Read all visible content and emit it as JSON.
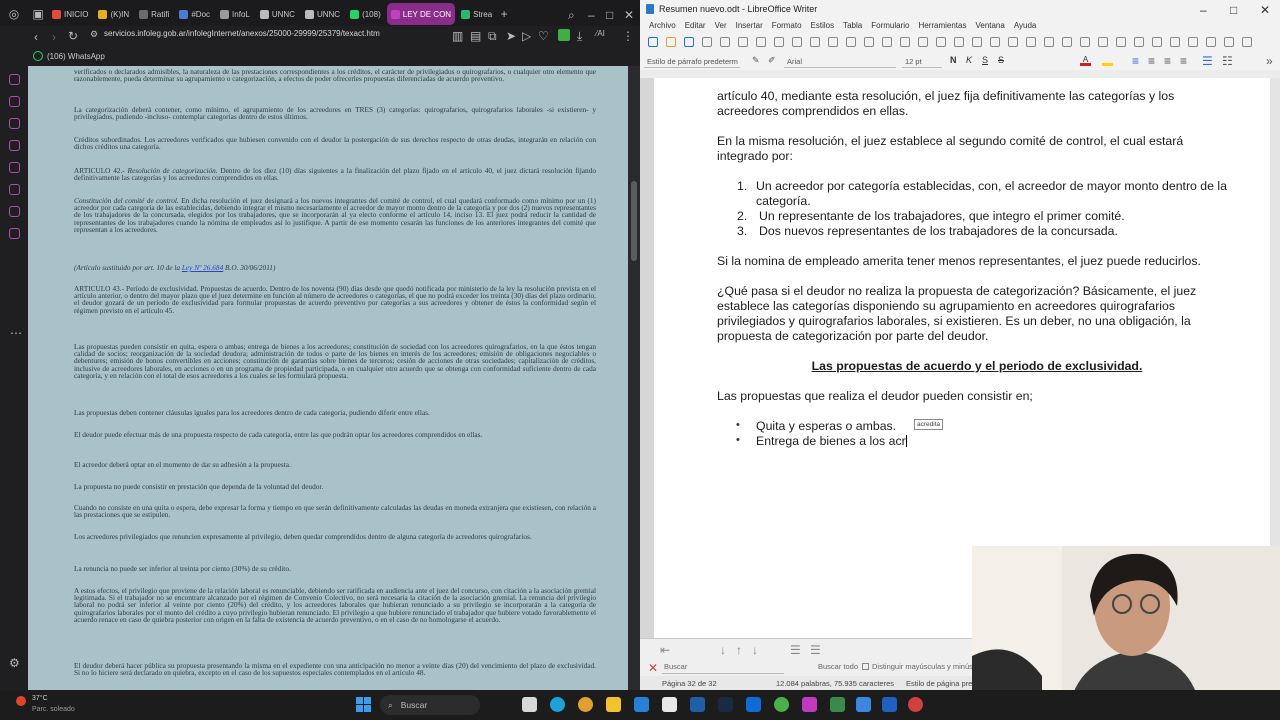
{
  "browser": {
    "tabs": [
      {
        "label": "INICIO",
        "color": "#e04b3a"
      },
      {
        "label": "(K)IN",
        "color": "#e8b020"
      },
      {
        "label": "Ratifi",
        "color": "#6b6b6b"
      },
      {
        "label": "#Doc",
        "color": "#4a7bd0"
      },
      {
        "label": "InfoL",
        "color": "#9a9a9a"
      },
      {
        "label": "UNNC",
        "color": "#bbbbbb"
      },
      {
        "label": "UNNC",
        "color": "#bbbbbb"
      },
      {
        "label": "(108)",
        "color": "#25d366"
      },
      {
        "label": "LEY DE CON",
        "color": "#c040c0",
        "active": true
      },
      {
        "label": "Strea",
        "color": "#2bb673"
      }
    ],
    "url": "servicios.infoleg.gob.ar/infolegInternet/anexos/25000-29999/25379/texact.htm",
    "bookmark": "(106) WhatsApp",
    "document": {
      "p1": "verificados o declarados admisibles, la naturaleza de las prestaciones correspondientes a los créditos, el carácter de privilegiados o quirografarios, o cualquier otro elemento que razonablemente, pueda determinar su agrupamiento o categorización, a efectos de poder ofrecerles propuestas diferenciadas de acuerdo preventivo.",
      "p2": "La categorización deberá contener, como mínimo, el agrupamiento de los acreedores en TRES (3) categorías: quirografarios, quirografarios laborales -si existieren- y privilegiados, pudiendo -incluso- contemplar categorías dentro de estos últimos.",
      "p3": "Créditos subordinados. Los acreedores verificados que hubiesen convenido con el deudor la postergación de sus derechos respecto de otras deudas, integrarán en relación con dichos créditos una categoría.",
      "p4a": "ARTICULO 42.- ",
      "p4b": "Resolución de categorización.",
      "p4c": " Dentro de los diez (10) días siguientes a la finalización del plazo fijado en el artículo 40, el juez dictará resolución fijando definitivamente las categorías y los acreedores comprendidos en ellas.",
      "p5a": "Constitución del comité de control.",
      "p5b": " En dicha resolución el juez designará a los nuevos integrantes del comité de control, el cual quedará conformado como mínimo por un (1) acreedor por cada categoría de las establecidas, debiendo integrar el mismo necesariamente el acreedor de mayor monto dentro de la categoría y por dos (2) nuevos representantes de los trabajadores de la concursada, elegidos por los trabajadores, que se incorporarán al ya electo conforme el artículo 14, inciso 13. El juez podrá reducir la cantidad de representantes de los trabajadores cuando la nómina de empleados así lo justifique. A partir de ese momento cesarán las funciones de los anteriores integrantes del comité que representan a los acreedores.",
      "p6a": "(Artículo sustituido por art. 10 de la ",
      "p6link": "Ley Nº 26.684",
      "p6b": " B.O. 30/06/2011)",
      "p7": "ARTICULO 43.- Período de exclusividad. Propuestas de acuerdo. Dentro de los noventa (90) días desde que quedó notificada por ministerio de la ley la resolución prevista en el artículo anterior, o dentro del mayor plazo que el juez determine en función al número de acreedores o categorías, el que no podrá exceder los treinta (30) días del plazo ordinario, el deudor gozará de un período de exclusividad para formular propuestas de acuerdo preventivo por categorías a sus acreedores y obtener de éstos la conformidad según el régimen previsto en el artículo 45.",
      "p8": "Las propuestas pueden consistir en quita, espera o ambas; entrega de bienes a los acreedores; constitución de sociedad con los acreedores quirografarios, en la que éstos tengan calidad de socios; reorganización de la sociedad deudora; administración de todos o parte de los bienes en interés de los acreedores; emisión de obligaciones negociables o debentures; emisión de bonos convertibles en acciones; constitución de garantías sobre bienes de terceros; cesión de acciones de otras sociedades; capitalización de créditos, inclusive de acreedores laborales, en acciones o en un programa de propiedad participada, o en cualquier otro acuerdo que se obtenga con conformidad suficiente dentro de cada categoría, y en relación con el total de esos acreedores a los cuales se les formulará propuesta.",
      "p9": "Las propuestas deben contener cláusulas iguales para los acreedores dentro de cada categoría, pudiendo diferir entre ellas.",
      "p10": "El deudor puede efectuar más de una propuesta respecto de cada categoría, entre las que podrán optar los acreedores comprendidos en ellas.",
      "p11": "El acreedor deberá optar en el momento de dar su adhesión a la propuesta.",
      "p12": "La propuesta no puede consistir en prestación que dependa de la voluntad del deudor.",
      "p13": "Cuando no consiste en una quita o espera, debe expresar la forma y tiempo en que serán definitivamente calculadas las deudas en moneda extranjera que existiesen, con relación a las prestaciones que se estipulen.",
      "p14": "Los acreedores privilegiados que renuncien expresamente al privilegio, deben quedar comprendidos dentro de alguna categoría de acreedores quirografarios.",
      "p15": "La renuncia no puede ser inferior al treinta por ciento (30%) de su crédito.",
      "p16": "A estos efectos, el privilegio que proviene de la relación laboral es renunciable, debiendo ser ratificada en audiencia ante el juez del concurso, con citación a la asociación gremial legitimada. Si el trabajador no se encontrare alcanzado por el régimen de Convenio Colectivo, no será necesaria la citación de la asociación gremial. La renuncia del privilegio laboral no podrá ser inferior al veinte por ciento (20%) del crédito, y los acreedores laborales que hubieran renunciado a su privilegio se incorporarán a la categoría de quirografarios laborales por el monto del crédito a cuyo privilegio hubieran renunciado. El privilegio a que hubiere renunciado el trabajador que hubiere votado favorablemente el acuerdo renace en caso de quiebra posterior con origen en la falta de existencia de acuerdo preventivo, o en el caso de no homologarse el acuerdo.",
      "p17": "El deudor deberá hacer pública su propuesta presentando la misma en el expediente con una anticipación no menor a veinte días (20) del vencimiento del plazo de exclusividad. Si no lo hiciere será declarado en quiebra, excepto en el caso de los supuestos especiales contemplados en el artículo 48."
    }
  },
  "writer": {
    "title": "Resumen nuevo.odt - LibreOffice Writer",
    "menu": [
      "Archivo",
      "Editar",
      "Ver",
      "Insertar",
      "Formato",
      "Estilos",
      "Tabla",
      "Formulario",
      "Herramientas",
      "Ventana",
      "Ayuda"
    ],
    "para_style": "Estilo de párrafo predeterm",
    "font_name": "Arial",
    "font_size": "12 pt",
    "body": {
      "l1": "artículo 40, mediante esta resolución, el juez fija definitivamente las categorías y los acreedores comprendidos en ellas.",
      "l2": "En la misma resolución, el juez establece al segundo comité de control, el cual estará integrado por:",
      "items": [
        {
          "num": "1.",
          "text": "Un acreedor por categoría establecidas, con, el acreedor de mayor monto dentro de la categoría."
        },
        {
          "num": "2.",
          "text": "Un representante de los trabajadores, que integro el primer comité."
        },
        {
          "num": "3.",
          "text": "Dos nuevos representantes de los trabajadores de la concursada."
        }
      ],
      "l3": "Si la nomina de empleado amerita tener menos representantes, el juez puede reducirlos.",
      "l4": "¿Qué pasa si el deudor no realiza la propuesta de categorización? Básicamente, el juez establece las categorías disponiendo su agrupamiento en acreedores quirografarios privilegiados y quirografarios laborales, si existieren. Es un deber, no una obligación, la propuesta de categorización por parte del deudor.",
      "heading": "Las propuestas de acuerdo y el periodo de exclusividad.",
      "l5": "Las propuestas que realiza el deudor pueden consistir en;",
      "bullets": [
        "Quita y esperas o ambas.",
        "Entrega de bienes a los acr"
      ],
      "tooltip": "acredita"
    },
    "find_placeholder": "Buscar",
    "find_all": "Buscar todo",
    "match_case": "Distinguir mayúsculas y minúsc",
    "status_page": "Página 32 de 32",
    "status_words": "12.084 palabras, 75.935 caracteres",
    "status_style": "Estilo de página pre"
  },
  "taskbar": {
    "weather_temp": "37°C",
    "weather_desc": "Parc. soleado",
    "search_label": "Buscar"
  }
}
